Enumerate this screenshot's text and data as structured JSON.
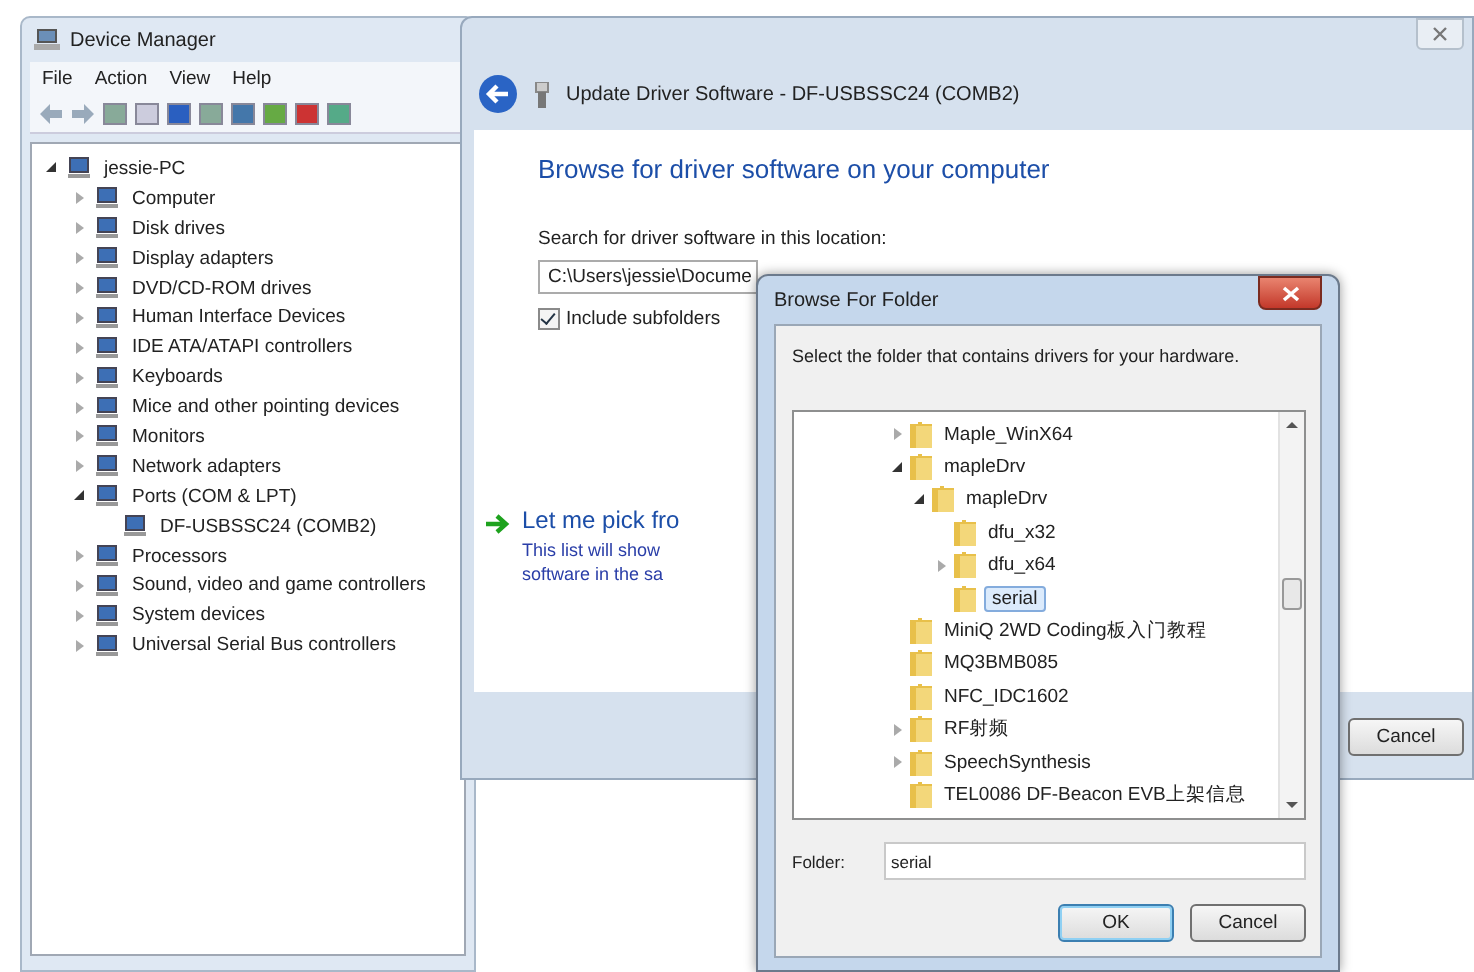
{
  "device_manager": {
    "title": "Device Manager",
    "menu": [
      "File",
      "Action",
      "View",
      "Help"
    ],
    "tree": [
      {
        "label": "jessie-PC",
        "kind": "branch",
        "expanded": true,
        "children": [
          {
            "label": "Computer",
            "kind": "branch",
            "expanded": false
          },
          {
            "label": "Disk drives",
            "kind": "branch",
            "expanded": false
          },
          {
            "label": "Display adapters",
            "kind": "branch",
            "expanded": false
          },
          {
            "label": "DVD/CD-ROM drives",
            "kind": "branch",
            "expanded": false
          },
          {
            "label": "Human Interface Devices",
            "kind": "branch",
            "expanded": false
          },
          {
            "label": "IDE ATA/ATAPI controllers",
            "kind": "branch",
            "expanded": false
          },
          {
            "label": "Keyboards",
            "kind": "branch",
            "expanded": false
          },
          {
            "label": "Mice and other pointing devices",
            "kind": "branch",
            "expanded": false
          },
          {
            "label": "Monitors",
            "kind": "branch",
            "expanded": false
          },
          {
            "label": "Network adapters",
            "kind": "branch",
            "expanded": false
          },
          {
            "label": "Ports (COM & LPT)",
            "kind": "branch",
            "expanded": true,
            "children": [
              {
                "label": "DF-USBSSC24 (COMB2)",
                "kind": "leaf"
              }
            ]
          },
          {
            "label": "Processors",
            "kind": "branch",
            "expanded": false
          },
          {
            "label": "Sound, video and game controllers",
            "kind": "branch",
            "expanded": false
          },
          {
            "label": "System devices",
            "kind": "branch",
            "expanded": false
          },
          {
            "label": "Universal Serial Bus controllers",
            "kind": "branch",
            "expanded": false
          }
        ]
      }
    ]
  },
  "update_driver": {
    "title": "Update Driver Software - DF-USBSSC24 (COMB2)",
    "heading": "Browse for driver software on your computer",
    "search_label": "Search for driver software in this location:",
    "path_value": "C:\\Users\\jessie\\Docume",
    "include_subfolders": {
      "label": "Include subfolders",
      "checked": true
    },
    "pick_link": "Let me pick fro",
    "pick_description": [
      "This list will show",
      "software in the sa"
    ],
    "cancel": "Cancel"
  },
  "browse_folder": {
    "title": "Browse For Folder",
    "instruction": "Select the folder that contains drivers for your hardware.",
    "tree": [
      {
        "label": "Maple_WinX64",
        "kind": "branch",
        "expanded": false,
        "selected": false
      },
      {
        "label": "mapleDrv",
        "kind": "branch",
        "expanded": true,
        "selected": false,
        "children": [
          {
            "label": "mapleDrv",
            "kind": "branch",
            "expanded": true,
            "selected": false,
            "children": [
              {
                "label": "dfu_x32",
                "kind": "leaf",
                "selected": false
              },
              {
                "label": "dfu_x64",
                "kind": "branch",
                "expanded": false,
                "selected": false
              },
              {
                "label": "serial",
                "kind": "leaf",
                "selected": true
              }
            ]
          }
        ]
      },
      {
        "label": "MiniQ 2WD Coding板入门教程",
        "kind": "leaf",
        "selected": false
      },
      {
        "label": "MQ3BMB085",
        "kind": "leaf",
        "selected": false
      },
      {
        "label": "NFC_IDC1602",
        "kind": "leaf",
        "selected": false
      },
      {
        "label": "RF射频",
        "kind": "branch",
        "expanded": false,
        "selected": false
      },
      {
        "label": "SpeechSynthesis",
        "kind": "branch",
        "expanded": false,
        "selected": false
      },
      {
        "label": "TEL0086 DF-Beacon EVB上架信息",
        "kind": "leaf",
        "selected": false
      }
    ],
    "folder_label": "Folder:",
    "folder_value": "serial",
    "ok": "OK",
    "cancel": "Cancel"
  }
}
